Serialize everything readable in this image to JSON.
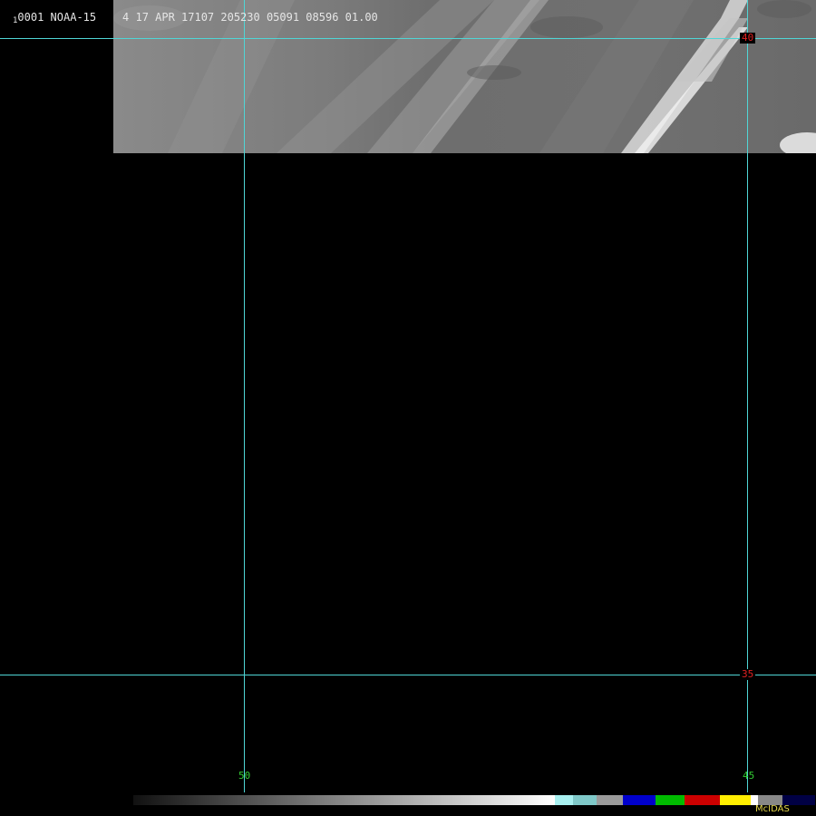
{
  "image": {
    "satellite_swath": "NOAA-15 infrared swath (grayscale clouds) over the upper portion of the frame; remainder is no-data (black)"
  },
  "grid": {
    "color": "#4fd6d6",
    "latitudes": [
      {
        "value": "40",
        "color": "#e02020"
      },
      {
        "value": "35",
        "color": "#e02020"
      }
    ],
    "longitudes": [
      {
        "value": "50",
        "color": "#33cc33"
      },
      {
        "value": "45",
        "color": "#33cc33"
      }
    ]
  },
  "footer": {
    "frame_sub": "1",
    "line": "0001 NOAA-15    4 17 APR 17107 205230 05091 08596 01.00",
    "brand": "McIDAS",
    "brand_color": "#e6d84a"
  },
  "colorbar": {
    "gradient_start": "#111111",
    "gradient_end": "#ffffff",
    "enhancement_colors": [
      "#a8f0f0",
      "#7fc8c8",
      "#9a9a9a",
      "#0000cc",
      "#00bb00",
      "#cc0000",
      "#ffee00",
      "#ffffff",
      "#888888",
      "#000044"
    ]
  }
}
